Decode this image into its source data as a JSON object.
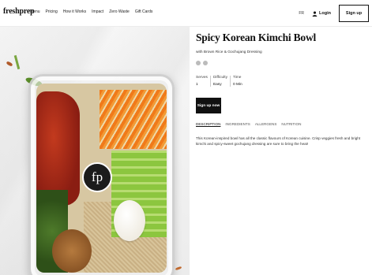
{
  "header": {
    "logo": "freshprep",
    "nav": [
      "Menu",
      "Pricing",
      "How it Works",
      "Impact",
      "Zero Waste",
      "Gift Cards"
    ],
    "flag_label": "FR",
    "login_label": "Login",
    "signup_label": "Sign up"
  },
  "hero": {
    "bowl_logo": "fp"
  },
  "recipe": {
    "title": "Spicy Korean Kimchi Bowl",
    "subtitle": "with Brown Rice & Gochujang Dressing",
    "diet_icons": [
      "dairy-free-icon",
      "vegetarian-icon"
    ],
    "facts": [
      {
        "label": "Serves",
        "value": "1"
      },
      {
        "label": "Difficulty",
        "value": "Easy"
      },
      {
        "label": "Time",
        "value": "0 Min"
      }
    ],
    "cta_label": "Sign up now",
    "tabs": [
      "DESCRIPTION",
      "INGREDIENTS",
      "ALLERGENS",
      "NUTRITION"
    ],
    "active_tab": "DESCRIPTION",
    "description": "This Korean-inspired bowl has all the classic flavours of Korean cuisine. Crisp veggies fresh and bright kimchi and spicy-sweet gochujang dressing are sure to bring the heat!"
  }
}
